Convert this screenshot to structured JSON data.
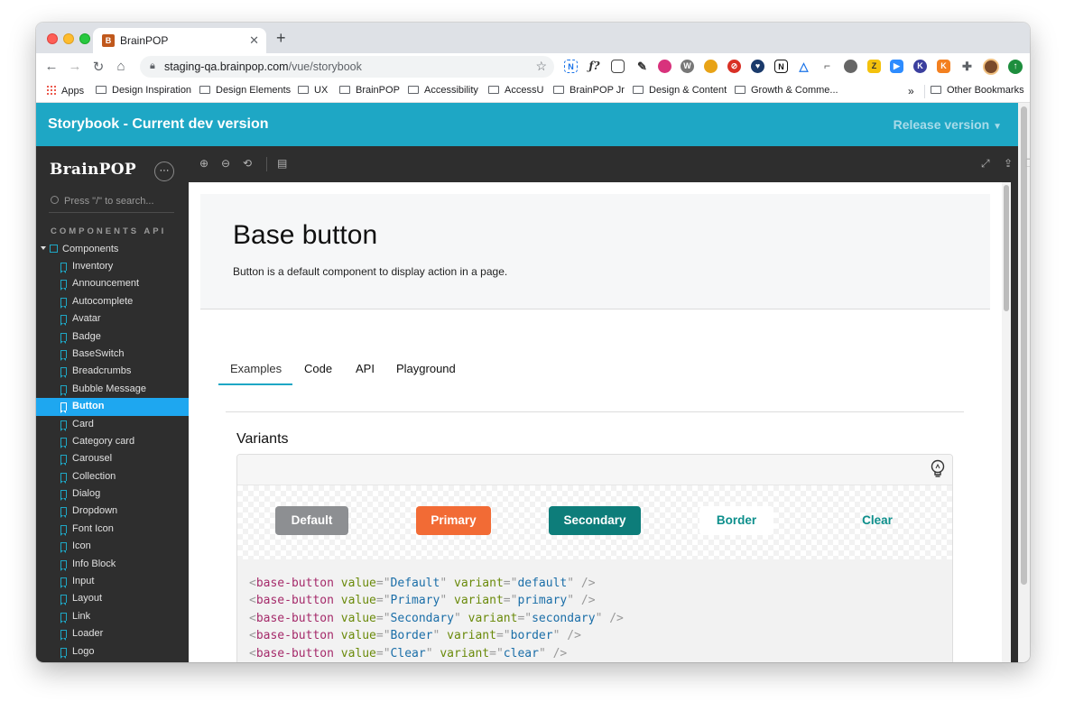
{
  "browser": {
    "tab_title": "BrainPOP",
    "tab_favicon": "B",
    "url_host": "staging-qa.brainpop.com",
    "url_path": "/vue/storybook",
    "bookmarks": [
      "Apps",
      "Design Inspiration",
      "Design Elements",
      "UX",
      "BrainPOP",
      "Accessibility",
      "AccessU",
      "BrainPOP Jr",
      "Design & Content",
      "Growth & Comme...",
      "Other Bookmarks"
    ],
    "overflow": "»"
  },
  "header": {
    "title": "Storybook - Current dev version",
    "release": "Release version"
  },
  "sidebar": {
    "brand": "BrainPOP",
    "menu": "···",
    "search_placeholder": "Press \"/\" to search...",
    "section": "COMPONENTS API",
    "group": "Components",
    "items": [
      "Inventory",
      "Announcement",
      "Autocomplete",
      "Avatar",
      "Badge",
      "BaseSwitch",
      "Breadcrumbs",
      "Bubble Message",
      "Button",
      "Card",
      "Category card",
      "Carousel",
      "Collection",
      "Dialog",
      "Dropdown",
      "Font Icon",
      "Icon",
      "Info Block",
      "Input",
      "Layout",
      "Link",
      "Loader",
      "Logo"
    ],
    "active_item": "Button"
  },
  "page": {
    "title": "Base button",
    "description": "Button is a default component to display action in a page.",
    "tabs": [
      "Examples",
      "Code",
      "API",
      "Playground"
    ],
    "active_tab": "Examples",
    "section_title": "Variants",
    "buttons": [
      "Default",
      "Primary",
      "Secondary",
      "Border",
      "Clear"
    ]
  },
  "code_lines": [
    {
      "tag": "base-button",
      "value": "Default",
      "variant": "default"
    },
    {
      "tag": "base-button",
      "value": "Primary",
      "variant": "primary"
    },
    {
      "tag": "base-button",
      "value": "Secondary",
      "variant": "secondary"
    },
    {
      "tag": "base-button",
      "value": "Border",
      "variant": "border"
    },
    {
      "tag": "base-button",
      "value": "Clear",
      "variant": "clear"
    }
  ],
  "colors": {
    "header_bg": "#1ea7c5",
    "sidebar_bg": "#2e2e2e",
    "active_item": "#1ea7f0",
    "primary": "#f26b35",
    "secondary": "#0d7d7a",
    "default": "#8d8f92"
  }
}
